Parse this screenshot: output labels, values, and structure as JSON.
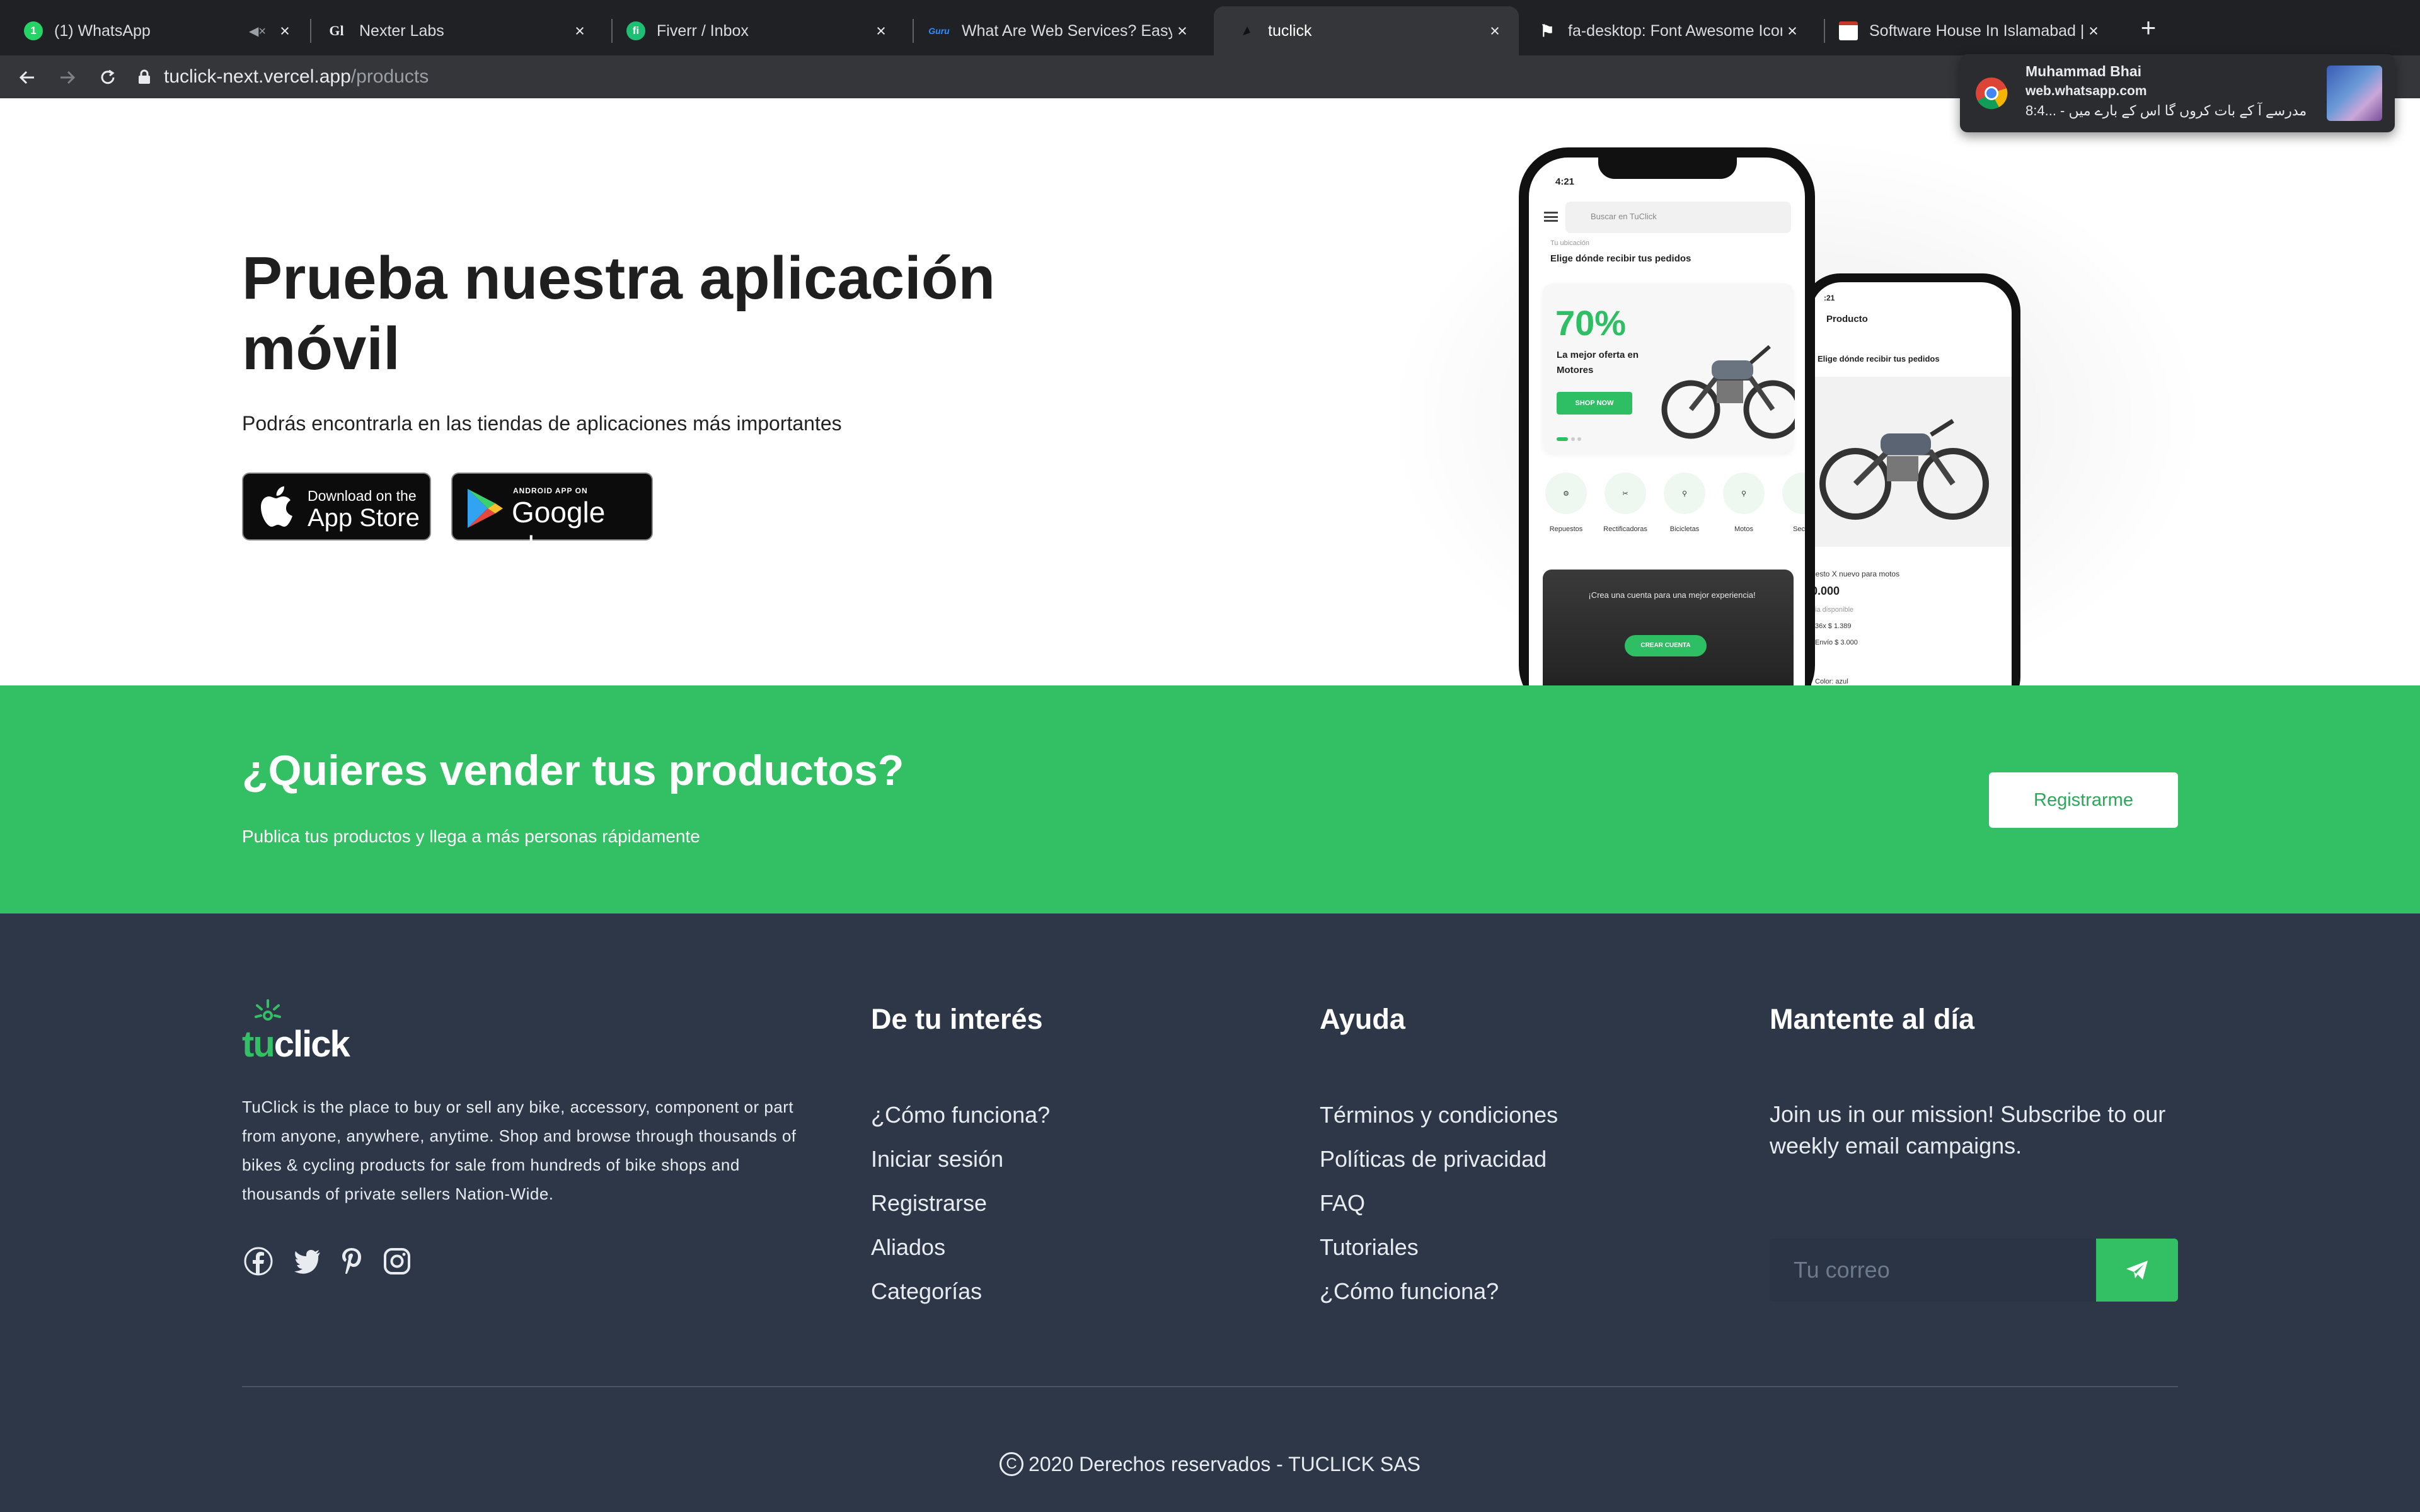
{
  "browser": {
    "tabs": [
      {
        "title": "(1) WhatsApp",
        "favicon": "whatsapp-icon",
        "favicon_text": "1",
        "favicon_color": "#25d366",
        "muted": true
      },
      {
        "title": "Nexter Labs",
        "favicon": "glint-icon",
        "favicon_text": "Glint",
        "favicon_color": "#202124"
      },
      {
        "title": "Fiverr / Inbox",
        "favicon": "fiverr-icon",
        "favicon_text": "fi",
        "favicon_color": "#1dbf73"
      },
      {
        "title": "What Are Web Services? Easy E",
        "favicon": "guru-icon",
        "favicon_text": "Guru",
        "favicon_color": "#202124"
      },
      {
        "title": "tuclick",
        "favicon": "tuclick-icon",
        "favicon_text": "",
        "favicon_color": "#202124"
      },
      {
        "title": "fa-desktop: Font Awesome Icon",
        "favicon": "flag-icon",
        "favicon_text": "⚑",
        "favicon_color": "#202124"
      },
      {
        "title": "Software House In Islamabad |",
        "favicon": "page-icon",
        "favicon_text": "",
        "favicon_color": "#ffffff"
      }
    ],
    "active_tab": 4,
    "url_host": "tuclick-next.vercel.app",
    "url_path": "/products",
    "new_tab_label": "+"
  },
  "notification": {
    "title": "Muhammad Bhai",
    "site": "web.whatsapp.com",
    "message": "مدرسے آ کے بات کروں گا اس کے بارے میں - ...8:4"
  },
  "hero": {
    "title": "Prueba nuestra aplicación móvil",
    "subtitle": "Podrás encontrarla en las tiendas de aplicaciones más importantes",
    "appstore_small": "Download on the",
    "appstore_big": "App Store",
    "gplay_small": "ANDROID APP ON",
    "gplay_big": "Google play"
  },
  "phone_main": {
    "time": "4:21",
    "search_placeholder": "Buscar en TuClick",
    "location_small": "Tu ubicación",
    "location": "Elige dónde recibir tus pedidos",
    "banner_pct": "70%",
    "banner_text": "La mejor oferta en Motores",
    "banner_button": "SHOP NOW",
    "categories": [
      "Repuestos",
      "Rectificadoras",
      "Bicicletas",
      "Motos",
      "Secret"
    ],
    "dark_text": "¡Crea una cuenta para una mejor experiencia!",
    "dark_button": "CREAR CUENTA"
  },
  "phone_product": {
    "time": ":21",
    "title": "Producto",
    "location": "Elige dónde recibir tus pedidos",
    "name": "uesto X nuevo para motos",
    "price": "0.000",
    "stock": "ia disponible",
    "installments": "36x $ 1.389",
    "shipping": "Envío $ 3.000",
    "color": "Color: azul"
  },
  "cta": {
    "title": "¿Quieres vender tus productos?",
    "subtitle": "Publica tus productos y llega a más personas rápidamente",
    "button": "Registrarme"
  },
  "footer": {
    "logo_tu": "tu",
    "logo_click": "click",
    "description": "TuClick is the place to buy or sell any bike, accessory, component or part from anyone, anywhere, anytime. Shop and browse through thousands of bikes & cycling products for sale from hundreds of bike shops and thousands of private sellers Nation-Wide.",
    "socials": [
      "facebook-icon",
      "twitter-icon",
      "pinterest-icon",
      "instagram-icon"
    ],
    "col_interest": {
      "title": "De tu interés",
      "links": [
        "¿Cómo funciona?",
        "Iniciar sesión",
        "Registrarse",
        "Aliados",
        "Categorías"
      ]
    },
    "col_help": {
      "title": "Ayuda",
      "links": [
        "Términos y condiciones",
        "Políticas de privacidad",
        "FAQ",
        "Tutoriales",
        "¿Cómo funciona?"
      ]
    },
    "col_news": {
      "title": "Mantente al día",
      "text": "Join us in our mission! Subscribe to our weekly email campaigns.",
      "email_placeholder": "Tu correo"
    },
    "copyright_symbol": "C",
    "copyright": "2020 Derechos reservados - TUCLICK SAS"
  },
  "colors": {
    "brand_green": "#33bf64",
    "footer_bg": "#2d3748",
    "chrome_dark": "#202124"
  }
}
